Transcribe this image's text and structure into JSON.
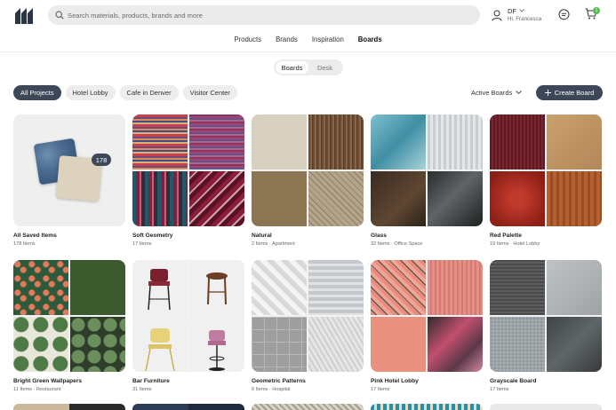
{
  "header": {
    "search_placeholder": "Search materials, products, brands and more",
    "user_initials": "DF",
    "user_greeting": "Hi, Francesca",
    "cart_count": "1"
  },
  "nav": {
    "items": [
      "Products",
      "Brands",
      "Inspiration",
      "Boards"
    ],
    "active": "Boards"
  },
  "view_toggle": {
    "options": [
      "Boards",
      "Desk"
    ],
    "selected": "Boards"
  },
  "filters": {
    "chips": [
      "All Projects",
      "Hotel Lobby",
      "Cafe in Denver",
      "Visitor Center"
    ],
    "active": "All Projects",
    "sort_label": "Active Boards",
    "create_label": "Create Board"
  },
  "colors": {
    "accent": "#3c4858",
    "badge_green": "#5cb85c"
  },
  "boards": [
    {
      "title": "All Saved Items",
      "meta": "178 Items",
      "badge": "178"
    },
    {
      "title": "Soft Geometry",
      "meta": "17 Items"
    },
    {
      "title": "Natural",
      "meta": "2 Items · Apartment"
    },
    {
      "title": "Glass",
      "meta": "32 Items · Office Space"
    },
    {
      "title": "Red Palette",
      "meta": "19 Items · Hotel Lobby"
    },
    {
      "title": "Bright Green Wallpapers",
      "meta": "11 Items · Restaurant"
    },
    {
      "title": "Bar Furniture",
      "meta": "31 Items"
    },
    {
      "title": "Geometric Patterns",
      "meta": "6 Items · Hospital"
    },
    {
      "title": "Pink Hotel Lobby",
      "meta": "17 Items"
    },
    {
      "title": "Grayscale Board",
      "meta": "17 Items"
    }
  ]
}
